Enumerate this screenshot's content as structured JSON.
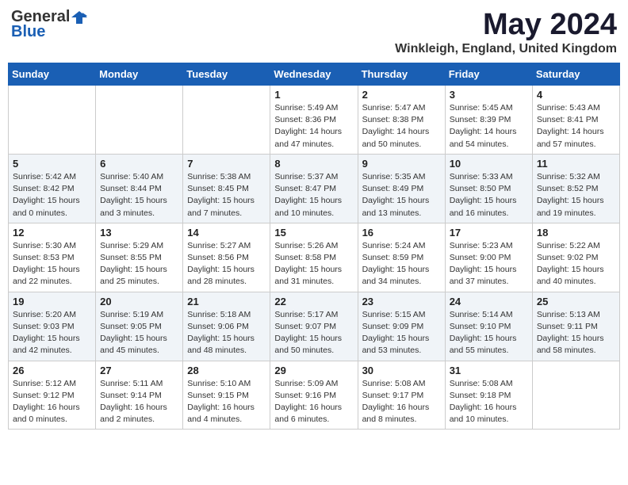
{
  "header": {
    "logo_general": "General",
    "logo_blue": "Blue",
    "month_title": "May 2024",
    "location": "Winkleigh, England, United Kingdom"
  },
  "columns": [
    "Sunday",
    "Monday",
    "Tuesday",
    "Wednesday",
    "Thursday",
    "Friday",
    "Saturday"
  ],
  "weeks": [
    [
      {
        "day": "",
        "info": ""
      },
      {
        "day": "",
        "info": ""
      },
      {
        "day": "",
        "info": ""
      },
      {
        "day": "1",
        "info": "Sunrise: 5:49 AM\nSunset: 8:36 PM\nDaylight: 14 hours\nand 47 minutes."
      },
      {
        "day": "2",
        "info": "Sunrise: 5:47 AM\nSunset: 8:38 PM\nDaylight: 14 hours\nand 50 minutes."
      },
      {
        "day": "3",
        "info": "Sunrise: 5:45 AM\nSunset: 8:39 PM\nDaylight: 14 hours\nand 54 minutes."
      },
      {
        "day": "4",
        "info": "Sunrise: 5:43 AM\nSunset: 8:41 PM\nDaylight: 14 hours\nand 57 minutes."
      }
    ],
    [
      {
        "day": "5",
        "info": "Sunrise: 5:42 AM\nSunset: 8:42 PM\nDaylight: 15 hours\nand 0 minutes."
      },
      {
        "day": "6",
        "info": "Sunrise: 5:40 AM\nSunset: 8:44 PM\nDaylight: 15 hours\nand 3 minutes."
      },
      {
        "day": "7",
        "info": "Sunrise: 5:38 AM\nSunset: 8:45 PM\nDaylight: 15 hours\nand 7 minutes."
      },
      {
        "day": "8",
        "info": "Sunrise: 5:37 AM\nSunset: 8:47 PM\nDaylight: 15 hours\nand 10 minutes."
      },
      {
        "day": "9",
        "info": "Sunrise: 5:35 AM\nSunset: 8:49 PM\nDaylight: 15 hours\nand 13 minutes."
      },
      {
        "day": "10",
        "info": "Sunrise: 5:33 AM\nSunset: 8:50 PM\nDaylight: 15 hours\nand 16 minutes."
      },
      {
        "day": "11",
        "info": "Sunrise: 5:32 AM\nSunset: 8:52 PM\nDaylight: 15 hours\nand 19 minutes."
      }
    ],
    [
      {
        "day": "12",
        "info": "Sunrise: 5:30 AM\nSunset: 8:53 PM\nDaylight: 15 hours\nand 22 minutes."
      },
      {
        "day": "13",
        "info": "Sunrise: 5:29 AM\nSunset: 8:55 PM\nDaylight: 15 hours\nand 25 minutes."
      },
      {
        "day": "14",
        "info": "Sunrise: 5:27 AM\nSunset: 8:56 PM\nDaylight: 15 hours\nand 28 minutes."
      },
      {
        "day": "15",
        "info": "Sunrise: 5:26 AM\nSunset: 8:58 PM\nDaylight: 15 hours\nand 31 minutes."
      },
      {
        "day": "16",
        "info": "Sunrise: 5:24 AM\nSunset: 8:59 PM\nDaylight: 15 hours\nand 34 minutes."
      },
      {
        "day": "17",
        "info": "Sunrise: 5:23 AM\nSunset: 9:00 PM\nDaylight: 15 hours\nand 37 minutes."
      },
      {
        "day": "18",
        "info": "Sunrise: 5:22 AM\nSunset: 9:02 PM\nDaylight: 15 hours\nand 40 minutes."
      }
    ],
    [
      {
        "day": "19",
        "info": "Sunrise: 5:20 AM\nSunset: 9:03 PM\nDaylight: 15 hours\nand 42 minutes."
      },
      {
        "day": "20",
        "info": "Sunrise: 5:19 AM\nSunset: 9:05 PM\nDaylight: 15 hours\nand 45 minutes."
      },
      {
        "day": "21",
        "info": "Sunrise: 5:18 AM\nSunset: 9:06 PM\nDaylight: 15 hours\nand 48 minutes."
      },
      {
        "day": "22",
        "info": "Sunrise: 5:17 AM\nSunset: 9:07 PM\nDaylight: 15 hours\nand 50 minutes."
      },
      {
        "day": "23",
        "info": "Sunrise: 5:15 AM\nSunset: 9:09 PM\nDaylight: 15 hours\nand 53 minutes."
      },
      {
        "day": "24",
        "info": "Sunrise: 5:14 AM\nSunset: 9:10 PM\nDaylight: 15 hours\nand 55 minutes."
      },
      {
        "day": "25",
        "info": "Sunrise: 5:13 AM\nSunset: 9:11 PM\nDaylight: 15 hours\nand 58 minutes."
      }
    ],
    [
      {
        "day": "26",
        "info": "Sunrise: 5:12 AM\nSunset: 9:12 PM\nDaylight: 16 hours\nand 0 minutes."
      },
      {
        "day": "27",
        "info": "Sunrise: 5:11 AM\nSunset: 9:14 PM\nDaylight: 16 hours\nand 2 minutes."
      },
      {
        "day": "28",
        "info": "Sunrise: 5:10 AM\nSunset: 9:15 PM\nDaylight: 16 hours\nand 4 minutes."
      },
      {
        "day": "29",
        "info": "Sunrise: 5:09 AM\nSunset: 9:16 PM\nDaylight: 16 hours\nand 6 minutes."
      },
      {
        "day": "30",
        "info": "Sunrise: 5:08 AM\nSunset: 9:17 PM\nDaylight: 16 hours\nand 8 minutes."
      },
      {
        "day": "31",
        "info": "Sunrise: 5:08 AM\nSunset: 9:18 PM\nDaylight: 16 hours\nand 10 minutes."
      },
      {
        "day": "",
        "info": ""
      }
    ]
  ]
}
